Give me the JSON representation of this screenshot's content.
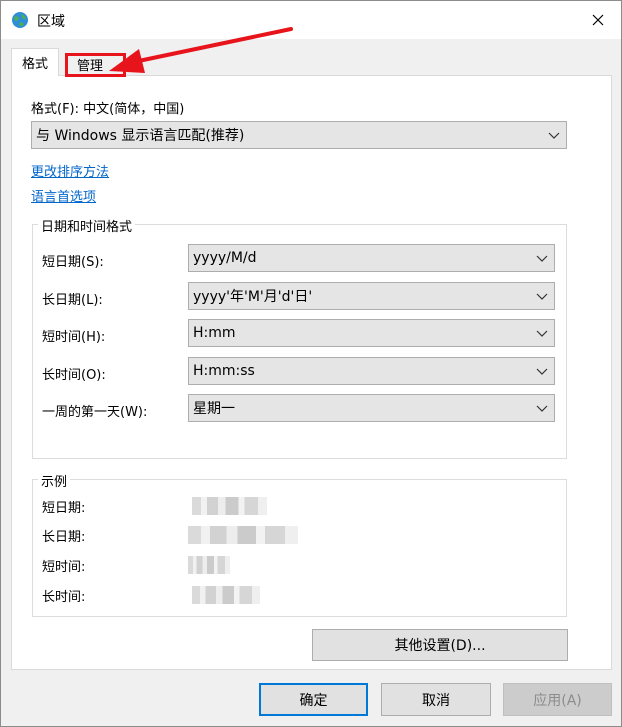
{
  "window": {
    "title": "区域"
  },
  "tabs": [
    {
      "label": "格式"
    },
    {
      "label": "管理"
    }
  ],
  "format": {
    "label": "格式(F): 中文(简体，中国)",
    "selected": "与 Windows 显示语言匹配(推荐)"
  },
  "links": {
    "sort": "更改排序方法",
    "language": "语言首选项"
  },
  "datetime": {
    "title": "日期和时间格式",
    "rows": [
      {
        "label": "短日期(S):",
        "value": "yyyy/M/d"
      },
      {
        "label": "长日期(L):",
        "value": "yyyy'年'M'月'd'日'"
      },
      {
        "label": "短时间(H):",
        "value": "H:mm"
      },
      {
        "label": "长时间(O):",
        "value": "H:mm:ss"
      },
      {
        "label": "一周的第一天(W):",
        "value": "星期一"
      }
    ]
  },
  "examples": {
    "title": "示例",
    "rows": [
      {
        "label": "短日期:"
      },
      {
        "label": "长日期:"
      },
      {
        "label": "短时间:"
      },
      {
        "label": "长时间:"
      }
    ]
  },
  "buttons": {
    "other_settings": "其他设置(D)...",
    "ok": "确定",
    "cancel": "取消",
    "apply": "应用(A)"
  },
  "colors": {
    "annotation_red": "#e8141c",
    "link_blue": "#0066cc",
    "focus_blue": "#0078d7"
  }
}
